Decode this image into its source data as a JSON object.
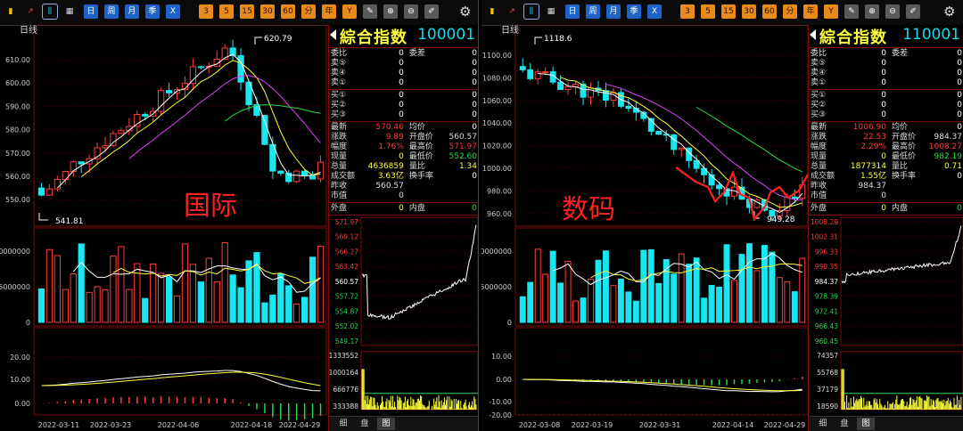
{
  "colors": {
    "up": "#ff3b3b",
    "down": "#19e6f0",
    "frame": "#7a0c0c",
    "grid": "#3a0000",
    "yellow": "#ffff3c",
    "cyan": "#19d7ec"
  },
  "toolbar": {
    "icons": [
      "bar-chart-icon",
      "line-chart-icon",
      "candlestick-icon",
      "calendar-icon"
    ],
    "period_buttons": [
      "日",
      "周",
      "月",
      "季",
      "X"
    ],
    "number_buttons": [
      "3",
      "5",
      "15",
      "30",
      "60",
      "分",
      "年",
      "Y"
    ],
    "tool_icons": [
      "edit-icon",
      "zoom-in-icon",
      "zoom-out-icon",
      "draw-icon",
      "settings-icon"
    ]
  },
  "left": {
    "period_label": "日线",
    "watermark": "国际",
    "price_axis": [
      "610.00",
      "600.00",
      "590.00",
      "580.00",
      "570.00",
      "560.00",
      "550.00"
    ],
    "high_marker": "620.79",
    "low_marker": "541.81",
    "volume_axis": [
      "10000000",
      "5000000",
      "0"
    ],
    "macd_axis": [
      "20.00",
      "10.00",
      "0.00"
    ],
    "dates": [
      "2022-03-11",
      "2022-03-23",
      "2022-04-06",
      "2022-04-18",
      "2022-04-29"
    ],
    "quote": {
      "name": "綜合指数",
      "code": "100001",
      "order_rows": [
        {
          "l": "委比",
          "v": "0",
          "l2": "委差",
          "v2": "0"
        },
        {
          "l": "卖⑤",
          "v": "0",
          "l2": "",
          "v2": "0"
        },
        {
          "l": "卖④",
          "v": "0",
          "l2": "",
          "v2": "0"
        },
        {
          "l": "卖①",
          "v": "0",
          "l2": "",
          "v2": "0"
        },
        {
          "l": "买①",
          "v": "0",
          "l2": "",
          "v2": "0"
        },
        {
          "l": "买②",
          "v": "0",
          "l2": "",
          "v2": "0"
        },
        {
          "l": "买③",
          "v": "0",
          "l2": "",
          "v2": "0"
        }
      ],
      "stats": [
        {
          "l": "最新",
          "v": "570.46",
          "l2": "均价",
          "v2": "0"
        },
        {
          "l": "涨跌",
          "v": "9.89",
          "l2": "开盘价",
          "v2": "560.57"
        },
        {
          "l": "幅度",
          "v": "1.76%",
          "l2": "最高价",
          "v2": "571.97"
        },
        {
          "l": "现量",
          "v": "0",
          "l2": "最低价",
          "v2": "552.60"
        },
        {
          "l": "总量",
          "v": "4636859",
          "l2": "量比",
          "v2": "1.34"
        },
        {
          "l": "成交额",
          "v": "3.63亿",
          "l2": "换手率",
          "v2": "0"
        },
        {
          "l": "昨收",
          "v": "560.57",
          "l2": "",
          "v2": ""
        },
        {
          "l": "市值",
          "v": "0",
          "l2": "",
          "v2": ""
        }
      ],
      "outer": {
        "l": "外盘",
        "v": "0",
        "l2": "内盘",
        "v2": "0"
      },
      "mini_price_axis": [
        "571.97",
        "569.12",
        "566.27",
        "563.42",
        "560.57",
        "557.72",
        "554.87",
        "552.02",
        "549.17"
      ],
      "mini_vol_axis": [
        "1333552",
        "1000164",
        "666776",
        "333388"
      ],
      "tabs": [
        "细",
        "盘",
        "图"
      ]
    }
  },
  "right": {
    "period_label": "日线",
    "watermark": "数码",
    "price_axis": [
      "1100.00",
      "1080.00",
      "1060.00",
      "1040.00",
      "1020.00",
      "1000.00",
      "980.00",
      "960.00"
    ],
    "high_marker": "1118.6",
    "low_marker": "949.28",
    "volume_axis": [
      "10000000",
      "5000000",
      "0"
    ],
    "macd_axis": [
      "10.00",
      "0.00",
      "-10.00",
      "-20.00"
    ],
    "dates": [
      "2022-03-08",
      "2022-03-19",
      "2022-03-31",
      "2022-04-14",
      "2022-04-29"
    ],
    "quote": {
      "name": "綜合指数",
      "code": "110001",
      "order_rows": [
        {
          "l": "委比",
          "v": "0",
          "l2": "委差",
          "v2": "0"
        },
        {
          "l": "卖⑤",
          "v": "0",
          "l2": "",
          "v2": "0"
        },
        {
          "l": "卖④",
          "v": "0",
          "l2": "",
          "v2": "0"
        },
        {
          "l": "卖①",
          "v": "0",
          "l2": "",
          "v2": "0"
        },
        {
          "l": "买①",
          "v": "0",
          "l2": "",
          "v2": "0"
        },
        {
          "l": "买②",
          "v": "0",
          "l2": "",
          "v2": "0"
        },
        {
          "l": "买③",
          "v": "0",
          "l2": "",
          "v2": "0"
        }
      ],
      "stats": [
        {
          "l": "最新",
          "v": "1006.90",
          "l2": "均价",
          "v2": "0"
        },
        {
          "l": "涨跌",
          "v": "22.53",
          "l2": "开盘价",
          "v2": "984.37"
        },
        {
          "l": "幅度",
          "v": "2.29%",
          "l2": "最高价",
          "v2": "1008.27"
        },
        {
          "l": "现量",
          "v": "0",
          "l2": "最低价",
          "v2": "982.19"
        },
        {
          "l": "总量",
          "v": "1877314",
          "l2": "量比",
          "v2": "0.71"
        },
        {
          "l": "成交额",
          "v": "1.55亿",
          "l2": "换手率",
          "v2": "0"
        },
        {
          "l": "昨收",
          "v": "984.37",
          "l2": "",
          "v2": ""
        },
        {
          "l": "市值",
          "v": "0",
          "l2": "",
          "v2": ""
        }
      ],
      "outer": {
        "l": "外盘",
        "v": "0",
        "l2": "内盘",
        "v2": "0"
      },
      "mini_price_axis": [
        "1008.29",
        "1002.31",
        "996.33",
        "990.35",
        "984.37",
        "978.39",
        "972.41",
        "966.43",
        "960.45"
      ],
      "mini_vol_axis": [
        "74357",
        "55768",
        "37179",
        "18590"
      ],
      "tabs": [
        "细",
        "盘",
        "图"
      ]
    }
  }
}
